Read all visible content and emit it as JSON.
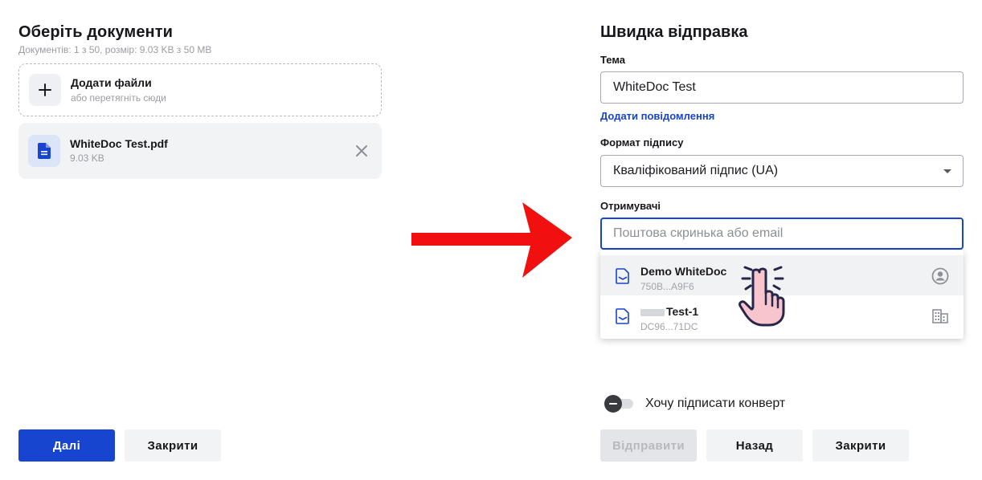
{
  "left": {
    "title": "Оберіть документи",
    "subtitle": "Документів: 1 з 50, розмір: 9.03 KB з 50 MB",
    "dropzone": {
      "title": "Додати файли",
      "hint": "або перетягніть сюди"
    },
    "file": {
      "name": "WhiteDoc Test.pdf",
      "size": "9.03 KB"
    },
    "buttons": {
      "next": "Далі",
      "close": "Закрити"
    }
  },
  "right": {
    "title": "Швидка відправка",
    "subject_label": "Тема",
    "subject_value": "WhiteDoc Test",
    "add_message": "Додати повідомлення",
    "format_label": "Формат підпису",
    "format_value": "Кваліфікований підпис (UA)",
    "recipients_label": "Отримувачі",
    "recipients_placeholder": "Поштова скринька або email",
    "suggestions": [
      {
        "name": "Demo WhiteDoc",
        "code": "750B...A9F6",
        "icon": "user-circle-icon"
      },
      {
        "name": "Test-1",
        "code": "DC96...71DC",
        "icon": "building-icon"
      }
    ],
    "envelope_toggle": {
      "label": "Хочу підписати конверт",
      "checked": false
    },
    "buttons": {
      "send": "Відправити",
      "back": "Назад",
      "close": "Закрити"
    }
  },
  "colors": {
    "primary": "#1745cf",
    "arrow": "#f01010",
    "light_bg": "#f2f3f5"
  }
}
